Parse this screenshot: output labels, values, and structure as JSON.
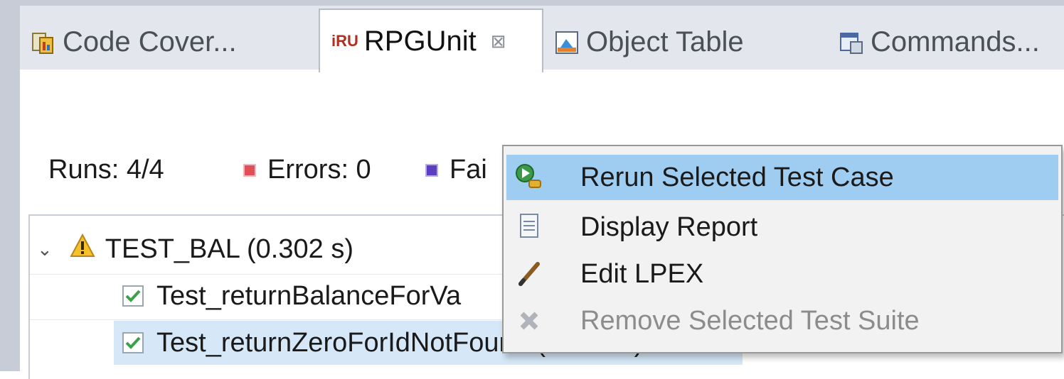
{
  "tabs": [
    {
      "label": "Code Cover...",
      "icon": "code-coverage-icon",
      "active": false
    },
    {
      "label": "RPGUnit",
      "icon": "rpgunit-icon",
      "badge": "iRU",
      "active": true,
      "close_symbol": "⊠"
    },
    {
      "label": "Object Table",
      "icon": "object-table-icon",
      "active": false
    },
    {
      "label": "Commands...",
      "icon": "commands-icon",
      "active": false
    }
  ],
  "stats": {
    "runs": "Runs: 4/4",
    "errors": "Errors: 0",
    "failures": "Fai"
  },
  "tree": {
    "suite": {
      "label": "TEST_BAL (0.302 s)",
      "icon": "warning-icon",
      "expanded": true
    },
    "cases": [
      {
        "label": "Test_returnBalanceForVa",
        "icon": "check-icon",
        "selected": false
      },
      {
        "label": "Test_returnZeroForIdNotFound (0.129 s)",
        "icon": "check-icon",
        "selected": true
      }
    ]
  },
  "context_menu": {
    "items": [
      {
        "label": "Rerun Selected Test Case",
        "icon": "rerun-icon",
        "highlighted": true,
        "enabled": true
      },
      {
        "label": "Display Report",
        "icon": "report-document-icon",
        "highlighted": false,
        "enabled": true
      },
      {
        "label": "Edit LPEX",
        "icon": "pencil-icon",
        "highlighted": false,
        "enabled": true
      },
      {
        "label": "Remove Selected Test Suite",
        "icon": "remove-x-icon",
        "highlighted": false,
        "enabled": false
      }
    ]
  },
  "colors": {
    "menu_highlight": "#9fcdf2",
    "selected_row": "#d6e8f8",
    "error_marker": "#e0505a",
    "failure_marker": "#5a3fc0",
    "check_green": "#3aa14a"
  }
}
